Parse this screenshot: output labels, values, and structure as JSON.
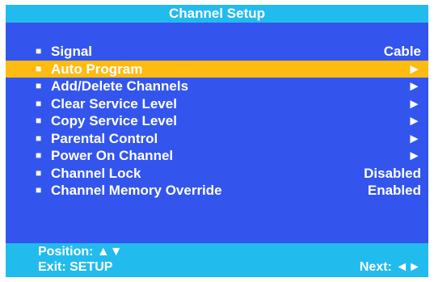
{
  "title": "Channel Setup",
  "menu": {
    "bullet": "■",
    "items": [
      {
        "label": "Signal",
        "value": "Cable"
      },
      {
        "label": "Auto Program",
        "value": "►"
      },
      {
        "label": "Add/Delete Channels",
        "value": "►"
      },
      {
        "label": "Clear Service Level",
        "value": "►"
      },
      {
        "label": "Copy Service Level",
        "value": "►"
      },
      {
        "label": "Parental Control",
        "value": "►"
      },
      {
        "label": "Power On Channel",
        "value": "►"
      },
      {
        "label": "Channel Lock",
        "value": "Disabled"
      },
      {
        "label": "Channel Memory Override",
        "value": "Enabled"
      }
    ]
  },
  "footer": {
    "position": "Position: ▲▼",
    "exit": "Exit: SETUP",
    "next": "Next: ◄►"
  },
  "colors": {
    "background": "#3355ee",
    "title_bar": "#22bbee",
    "highlight": "#ffbb11",
    "text": "#ffffff"
  }
}
